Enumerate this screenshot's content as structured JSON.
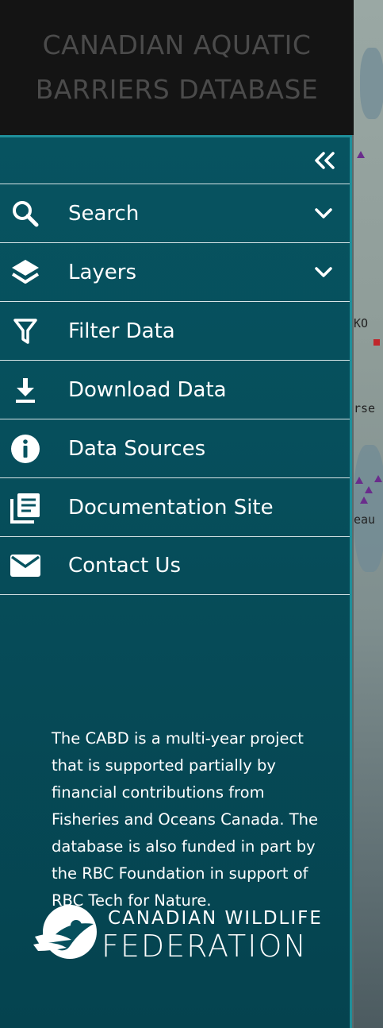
{
  "header": {
    "title_line1": "CANADIAN AQUATIC",
    "title_line2": "BARRIERS DATABASE"
  },
  "map": {
    "labels": [
      "KO",
      "rse",
      "eau"
    ]
  },
  "sidebar": {
    "collapse_icon": "double-chevron-left-icon",
    "items": [
      {
        "label": "Search",
        "icon": "search-icon",
        "expandable": true
      },
      {
        "label": "Layers",
        "icon": "layers-icon",
        "expandable": true
      },
      {
        "label": "Filter Data",
        "icon": "filter-icon",
        "expandable": false
      },
      {
        "label": "Download Data",
        "icon": "download-icon",
        "expandable": false
      },
      {
        "label": "Data Sources",
        "icon": "info-icon",
        "expandable": false
      },
      {
        "label": "Documentation Site",
        "icon": "documentation-icon",
        "expandable": false
      },
      {
        "label": "Contact Us",
        "icon": "mail-icon",
        "expandable": false
      }
    ],
    "about_text": "The CABD is a multi-year project that is supported partially by financial contributions from Fisheries and Oceans Canada. The database is also funded in part by the RBC Foundation in support of RBC Tech for Nature.",
    "logo": {
      "line1": "CANADIAN WILDLIFE",
      "line2": "FEDERATION"
    }
  },
  "colors": {
    "header_bg": "#141414",
    "header_text": "#4b4b4b",
    "sidebar_bg": "#075360",
    "sidebar_border": "#1f8f9a",
    "text": "#ffffff"
  }
}
